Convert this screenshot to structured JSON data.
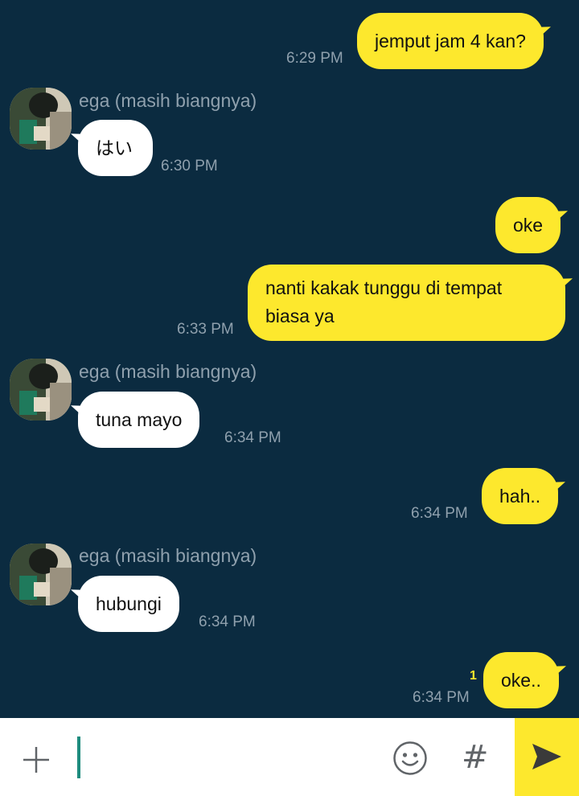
{
  "messages": [
    {
      "dir": "out",
      "text": "jemput jam 4 kan?",
      "time": "6:29 PM"
    },
    {
      "dir": "in",
      "sender": "ega (masih biangnya)",
      "text": "はい",
      "time": "6:30 PM"
    },
    {
      "dir": "out",
      "text": "oke",
      "time": ""
    },
    {
      "dir": "out",
      "text": "nanti kakak tunggu di tempat biasa ya",
      "time": "6:33 PM"
    },
    {
      "dir": "in",
      "sender": "ega (masih biangnya)",
      "text": "tuna mayo",
      "time": "6:34 PM"
    },
    {
      "dir": "out",
      "text": "hah..",
      "time": "6:34 PM"
    },
    {
      "dir": "in",
      "sender": "ega (masih biangnya)",
      "text": "hubungi",
      "time": "6:34 PM"
    },
    {
      "dir": "out",
      "text": "oke..",
      "time": "6:34 PM",
      "read_count": "1"
    }
  ],
  "composer": {
    "plus_icon": "plus-icon",
    "emoji_icon": "emoji-icon",
    "hash_label": "#",
    "send_icon": "send-icon"
  },
  "colors": {
    "background": "#0b2b40",
    "outgoing_bubble": "#fde82d",
    "incoming_bubble": "#ffffff",
    "meta_text": "#8fa0ad",
    "cursor": "#1e8c7e"
  }
}
